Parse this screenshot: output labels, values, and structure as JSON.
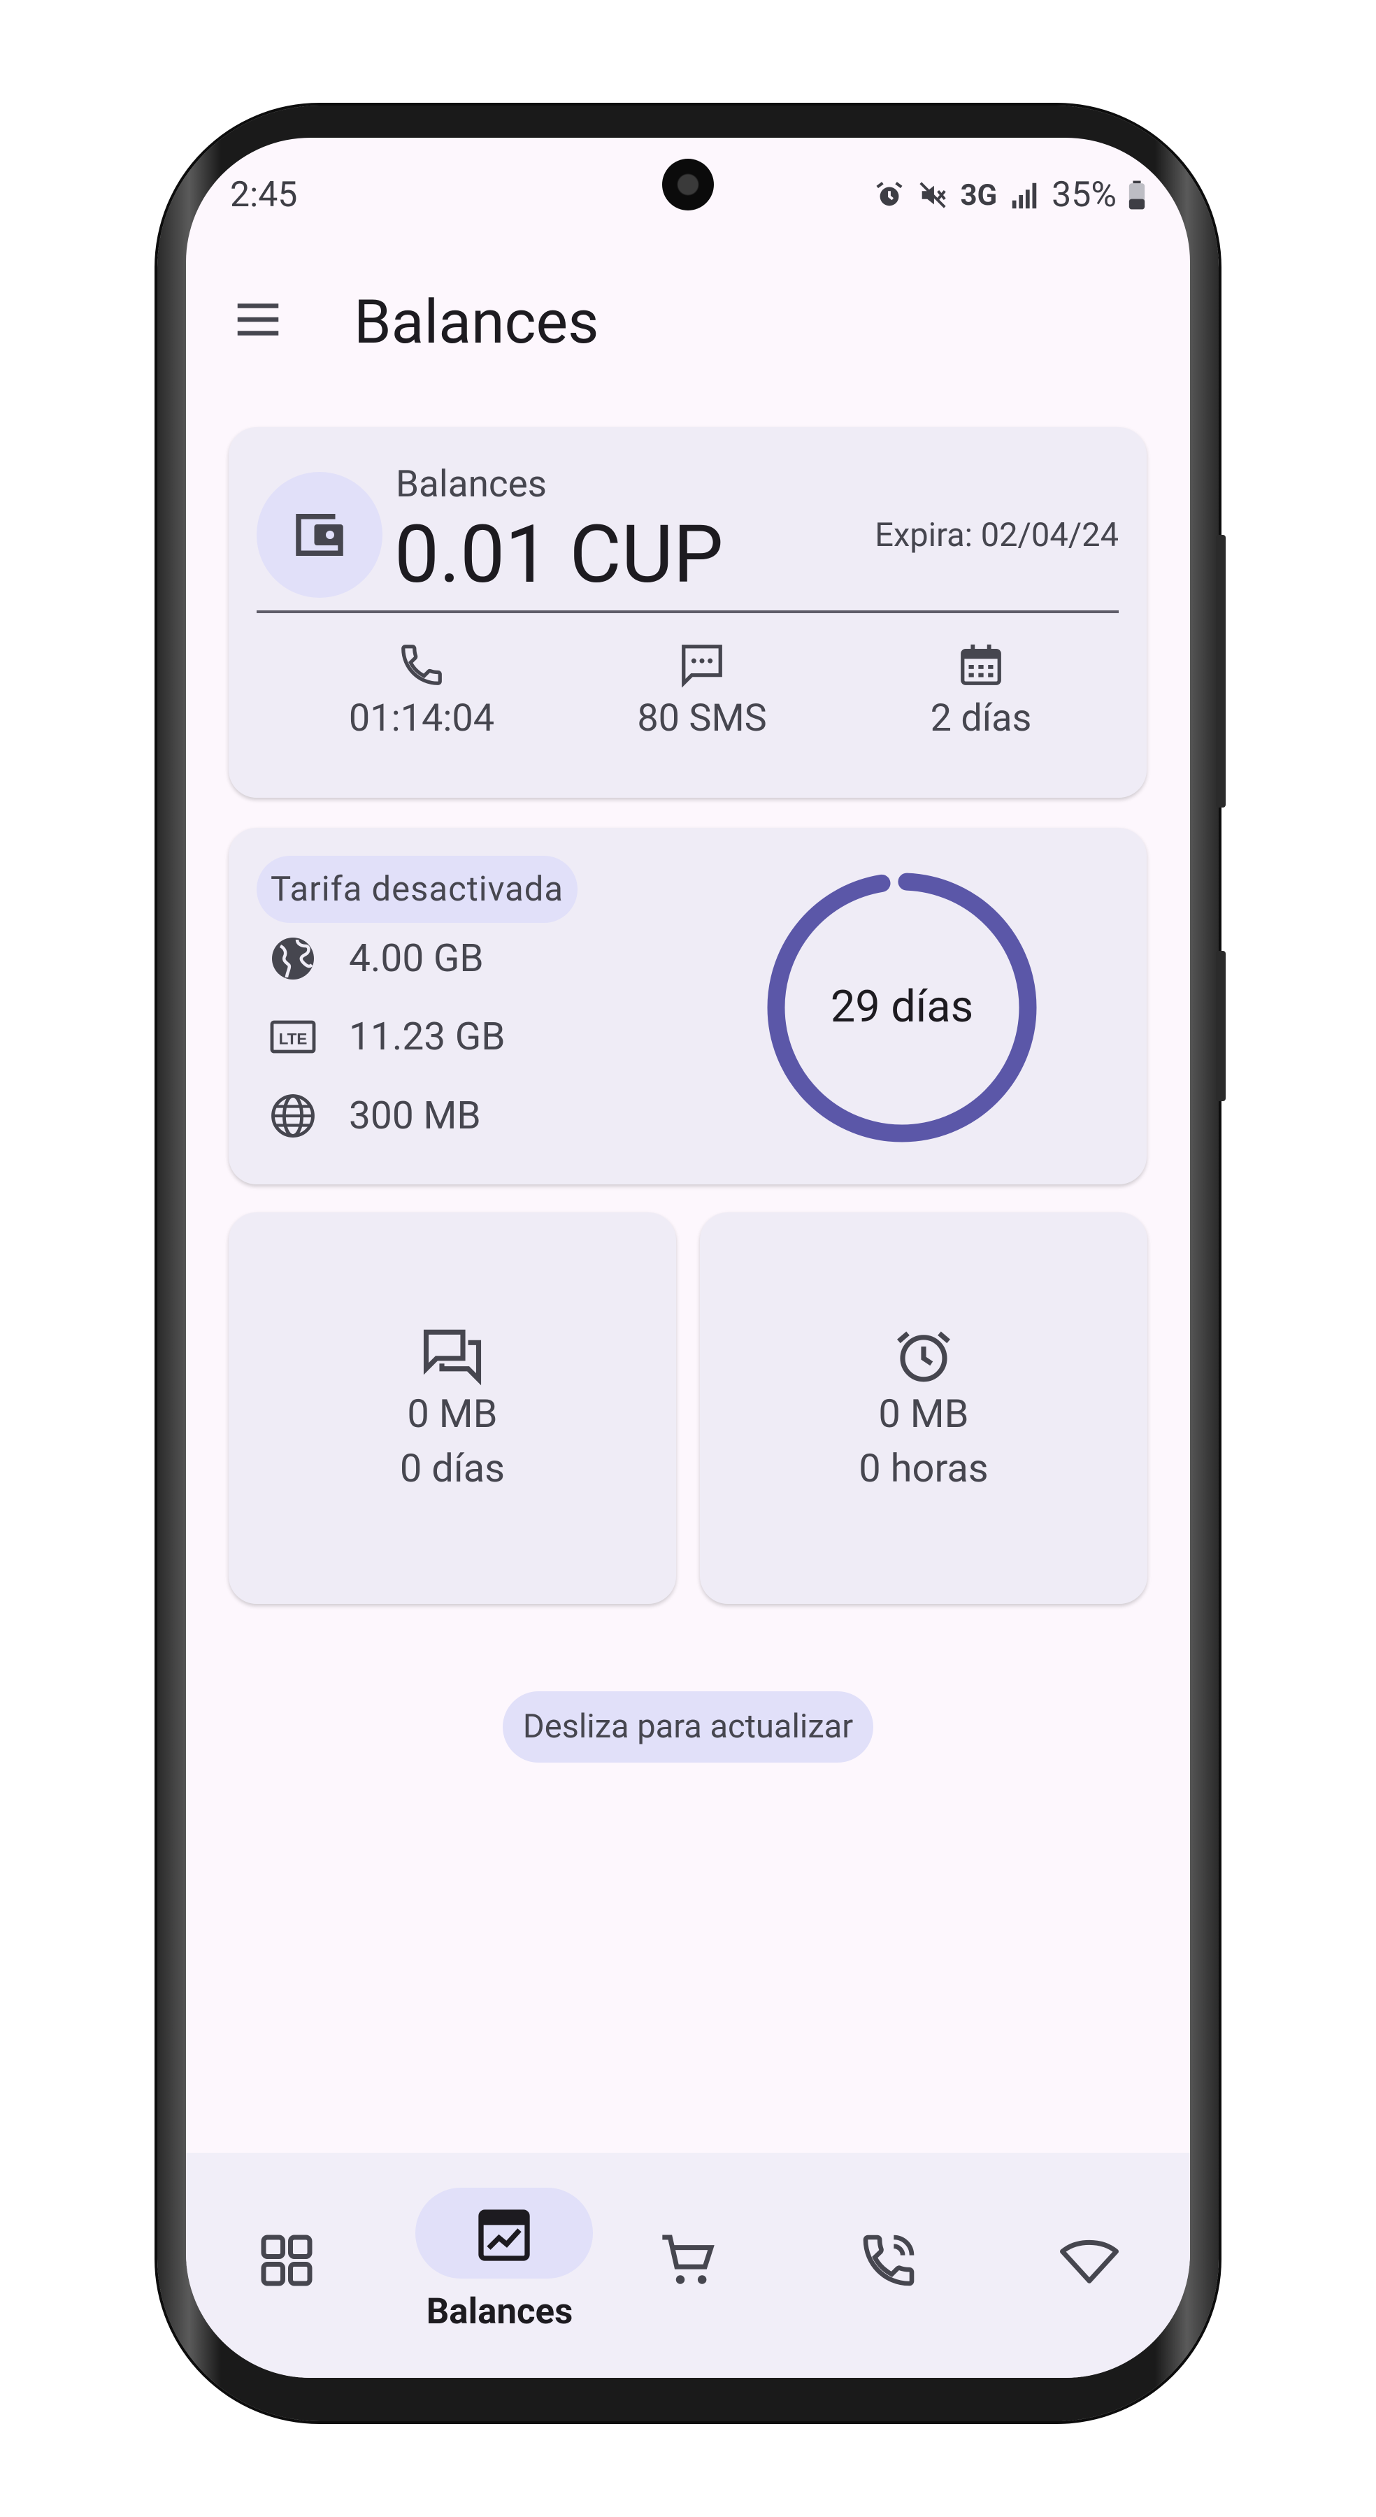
{
  "status_bar": {
    "time": "2:45",
    "network": "3G",
    "battery": "35%",
    "icons": [
      "alarm-icon",
      "mute-icon",
      "signal-icon",
      "battery-icon"
    ]
  },
  "app_bar": {
    "title": "Balances",
    "menu_icon": "menu-icon"
  },
  "balance_card": {
    "label": "Balances",
    "amount": "0.01 CUP",
    "expiry": "Expira: 02/04/24",
    "stats": [
      {
        "icon": "phone-icon",
        "value": "01:14:04"
      },
      {
        "icon": "sms-icon",
        "value": "80 SMS"
      },
      {
        "icon": "calendar-icon",
        "value": "2 días"
      }
    ]
  },
  "plan_card": {
    "status_chip": "Tarifa desactivada",
    "rows": [
      {
        "icon": "globe-filled-icon",
        "value": "4.00 GB"
      },
      {
        "icon": "lte-icon",
        "value": "11.23 GB"
      },
      {
        "icon": "globe-outline-icon",
        "value": "300 MB"
      }
    ],
    "ring": {
      "label": "29 días",
      "progress": 0.98,
      "color": "#5b57a8"
    }
  },
  "small_cards": [
    {
      "icon": "chat-icon",
      "line1": "0 MB",
      "line2": "0 días"
    },
    {
      "icon": "alarm-clock-icon",
      "line1": "0 MB",
      "line2": "0 horas"
    }
  ],
  "refresh_hint": "Desliza para actualizar",
  "bottom_nav": {
    "items": [
      {
        "icon": "grid-icon",
        "label": ""
      },
      {
        "icon": "balances-chart-icon",
        "label": "Balances",
        "active": true
      },
      {
        "icon": "cart-icon",
        "label": ""
      },
      {
        "icon": "phone-call-icon",
        "label": ""
      },
      {
        "icon": "wifi-icon",
        "label": ""
      }
    ]
  },
  "colors": {
    "accent": "#5b57a8",
    "card_bg": "#efecf6",
    "chip_bg": "#e1e0f9",
    "screen_bg": "#fdf7fd"
  }
}
